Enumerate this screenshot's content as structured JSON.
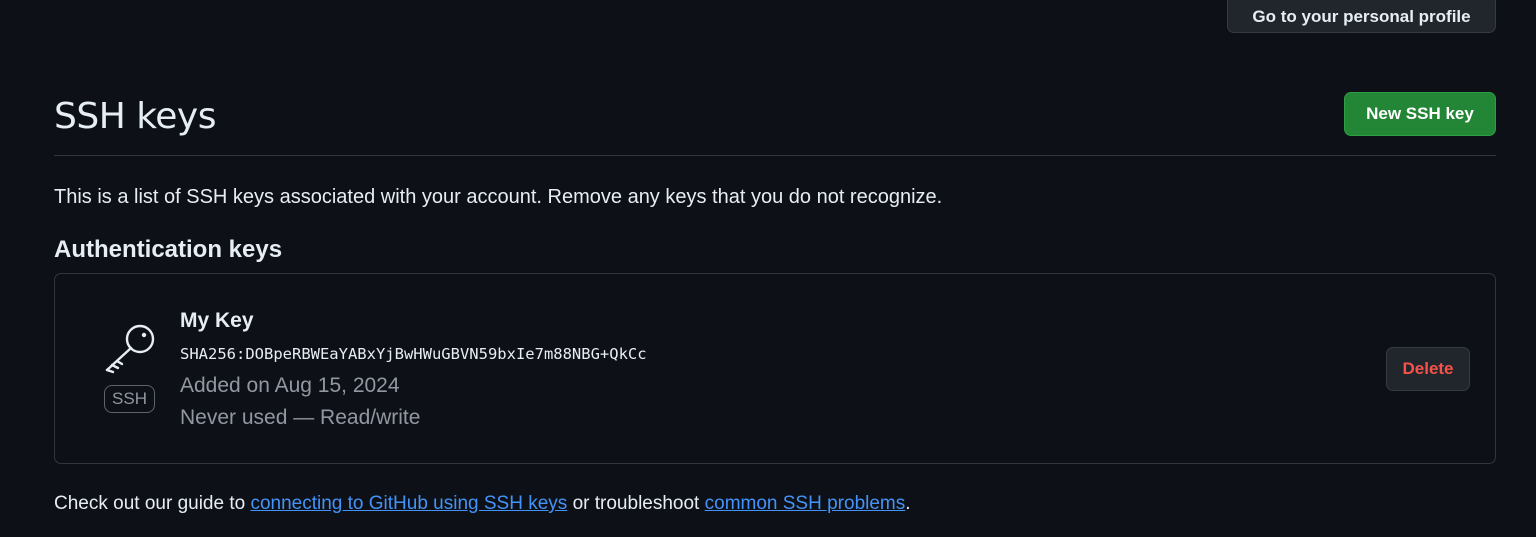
{
  "header": {
    "profile_button": "Go to your personal profile"
  },
  "ssh": {
    "title": "SSH keys",
    "new_button": "New SSH key",
    "intro": "This is a list of SSH keys associated with your account. Remove any keys that you do not recognize.",
    "section_title": "Authentication keys",
    "keys": [
      {
        "badge": "SSH",
        "name": "My Key",
        "fingerprint": "SHA256:DOBpeRBWEaYABxYjBwHWuGBVN59bxIe7m88NBG+QkCc",
        "added": "Added on Aug 15, 2024",
        "usage": "Never used — Read/write",
        "delete_label": "Delete",
        "icon": "key-icon"
      }
    ]
  },
  "footer": {
    "prefix": "Check out our guide to ",
    "link1": "connecting to GitHub using SSH keys",
    "middle": " or troubleshoot ",
    "link2": "common SSH problems",
    "suffix": "."
  },
  "colors": {
    "background": "#0d1117",
    "primary_button": "#238636",
    "danger_text": "#f85149",
    "link": "#4493f8",
    "muted_text": "#9198a1"
  }
}
